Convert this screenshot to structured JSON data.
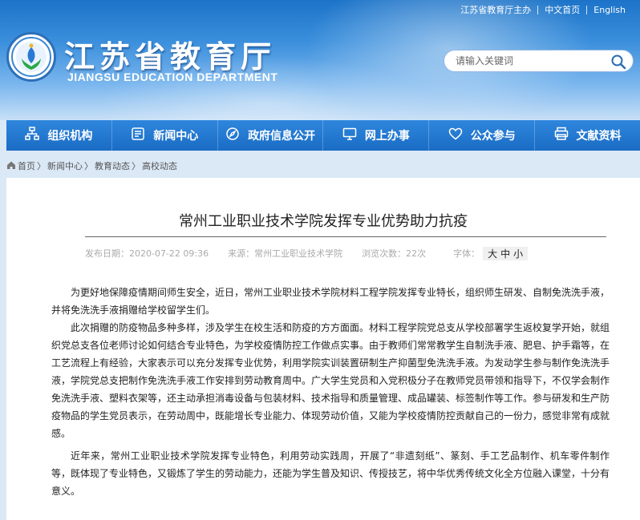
{
  "top_links": {
    "host": "江苏省教育厅主办",
    "chinese": "中文首页",
    "english": "English"
  },
  "site": {
    "title": "江苏省教育厅",
    "subtitle": "JIANGSU EDUCATION DEPARTMENT"
  },
  "search": {
    "placeholder": "请输入关键词"
  },
  "nav": [
    {
      "label": "组织机构",
      "icon": "org-chart-icon"
    },
    {
      "label": "新闻中心",
      "icon": "news-icon"
    },
    {
      "label": "政府信息公开",
      "icon": "compass-icon"
    },
    {
      "label": "网上办事",
      "icon": "monitor-icon"
    },
    {
      "label": "公众参与",
      "icon": "heart-icon"
    },
    {
      "label": "文献资料",
      "icon": "printer-icon"
    }
  ],
  "breadcrumb": [
    "首页",
    "新闻中心",
    "教育动态",
    "高校动态"
  ],
  "article": {
    "title": "常州工业职业技术学院发挥专业优势助力抗疫",
    "published": "发布日期：2020-07-22 09:36",
    "source": "来源：常州工业职业技术学院",
    "views": "浏览次数：22次",
    "font_label": "字体：",
    "font_large": "大",
    "font_medium": "中",
    "font_small": "小",
    "paragraphs": [
      "为更好地保障疫情期间师生安全，近日，常州工业职业技术学院材料工程学院发挥专业特长，组织师生研发、自制免洗洗手液，并将免洗洗手液捐赠给学校留学生们。",
      "此次捐赠的防疫物品多种多样，涉及学生在校生活和防疫的方方面面。材料工程学院党总支从学校部署学生返校复学开始，就组织党总支各位老师讨论如何结合专业特色，为学校疫情防控工作做点实事。由于教师们常常教学生自制洗手液、肥皂、护手霜等，在工艺流程上有经验，大家表示可以充分发挥专业优势，利用学院实训装置研制生产抑菌型免洗洗手液。为发动学生参与制作免洗洗手液，学院党总支把制作免洗洗手液工作安排到劳动教育周中。广大学生党员和入党积极分子在教师党员带领和指导下，不仅学会制作免洗洗手液、塑料衣架等，还主动承担消毒设备与包装材料、技术指导和质量管理、成品罐装、标签制作等工作。参与研发和生产防疫物品的学生党员表示，在劳动周中，既能增长专业能力、体现劳动价值，又能为学校疫情防控贡献自己的一份力，感觉非常有成就感。",
      "近年来，常州工业职业技术学院发挥专业特色，利用劳动实践周，开展了“非遗刻纸”、篆刻、手工艺品制作、机车零件制作等，既体现了专业特色，又锻炼了学生的劳动能力，还能为学生普及知识、传授技艺，将中华优秀传统文化全方位融入课堂，十分有意义。"
    ]
  }
}
